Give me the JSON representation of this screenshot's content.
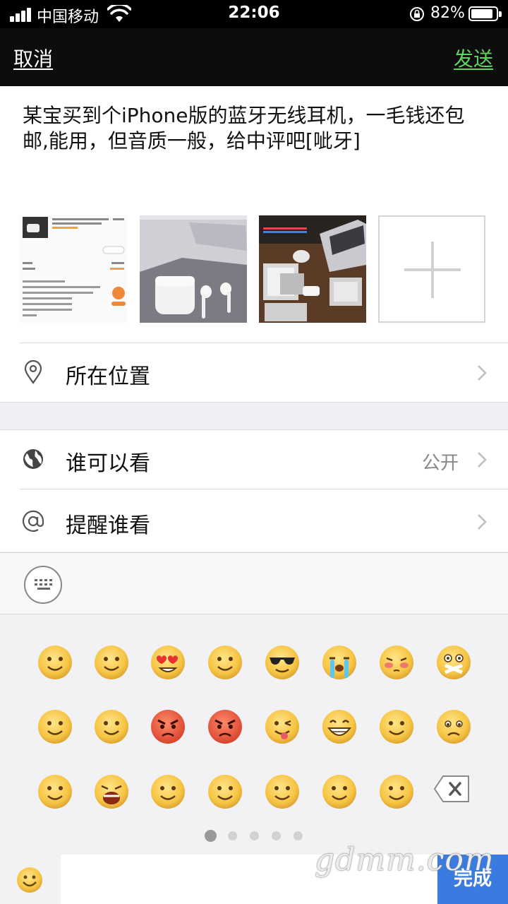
{
  "status_bar": {
    "carrier": "中国移动",
    "time": "22:06",
    "battery_percent": "82%",
    "battery_level": 0.82
  },
  "nav": {
    "cancel_label": "取消",
    "send_label": "发送",
    "send_color": "#5fd35b"
  },
  "compose": {
    "text": "某宝买到个iPhone版的蓝牙无线耳机，一毛钱还包邮,能用，但音质一般，给中评吧[呲牙]",
    "photos": [
      {
        "name": "order-screenshot-thumbnail"
      },
      {
        "name": "earbuds-case-photo-thumbnail"
      },
      {
        "name": "unboxing-desk-photo-thumbnail"
      }
    ],
    "add_photo_icon": "plus-icon"
  },
  "rows": {
    "location": {
      "label": "所在位置",
      "icon": "location-pin-icon"
    },
    "visibility": {
      "label": "谁可以看",
      "value": "公开",
      "icon": "globe-icon"
    },
    "mention": {
      "label": "提醒谁看",
      "icon": "at-icon"
    }
  },
  "emoji_panel": {
    "keyboard_icon": "keyboard-icon",
    "page_count": 5,
    "current_page": 1,
    "done_label": "完成",
    "done_color": "#3a7be0",
    "emojis": [
      "smile",
      "blush-wavy",
      "heart-eyes",
      "shocked",
      "cool-sunglasses",
      "crying",
      "shy-blush",
      "sealed-lips",
      "sleepy",
      "tears-of-joy",
      "angry-red",
      "furious",
      "wink-tongue",
      "grin",
      "surprised",
      "sad",
      "wide-eyes",
      "screaming",
      "drooling",
      "face-palm",
      "smiling",
      "worried",
      "skeptical"
    ]
  },
  "watermark": "gdmm.com"
}
